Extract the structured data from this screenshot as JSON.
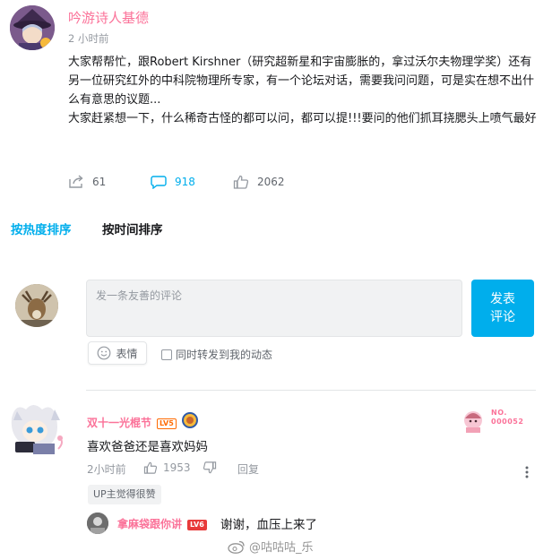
{
  "post": {
    "author": "吟游诗人基德",
    "time": "2 小时前",
    "body": [
      "大家帮帮忙，跟Robert Kirshner（研究超新星和宇宙膨胀的，拿过沃尔夫物理学奖）还有另一位研究红外的中科院物理所专家，有一个论坛对话，需要我问问题，可是实在想不出什么有意思的议题...",
      "大家赶紧想一下，什么稀奇古怪的都可以问，都可以提!!!要问的他们抓耳挠腮头上喷气最好"
    ],
    "stats": {
      "reposts": "61",
      "comments": "918",
      "likes": "2062"
    }
  },
  "sort_tabs": {
    "hot": "按热度排序",
    "time": "按时间排序"
  },
  "composer": {
    "placeholder": "发一条友善的评论",
    "submit_line1": "发表",
    "submit_line2": "评论",
    "emoji_label": "表情",
    "forward_label": "同时转发到我的动态"
  },
  "comments": [
    {
      "username": "双十一光棍节",
      "level": "LV5",
      "fan_no": "NO.",
      "fan_code": "000052",
      "text": "喜欢爸爸还是喜欢妈妈",
      "time": "2小时前",
      "likes": "1953",
      "reply_label": "回复",
      "up_badge": "UP主觉得很赞",
      "replies": [
        {
          "username": "拿麻袋跟你讲",
          "level": "LV6",
          "text": "谢谢，血压上来了"
        }
      ]
    }
  ],
  "watermark": "@咕咕咕_乐",
  "colors": {
    "accent": "#00aeec",
    "vip_pink": "#fb7299",
    "text": "#18191c",
    "muted": "#9499a0"
  }
}
